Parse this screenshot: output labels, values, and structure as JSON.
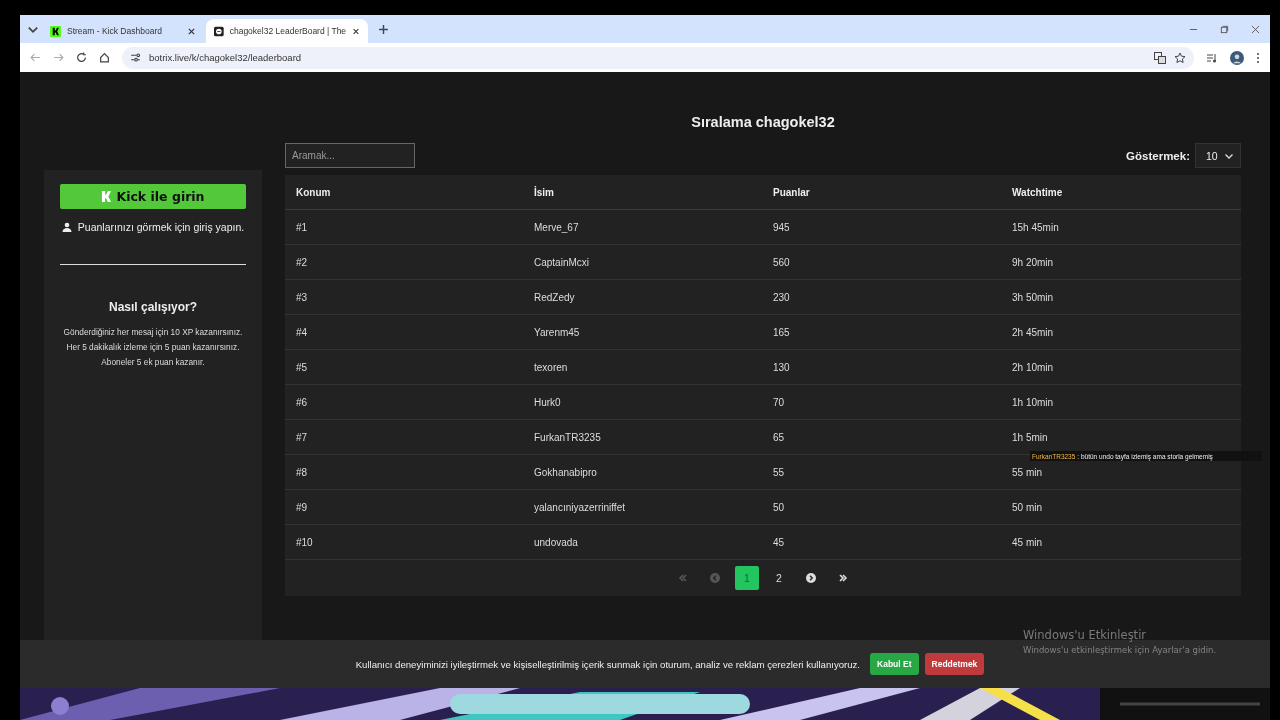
{
  "browser": {
    "tabs": [
      {
        "title": "Stream - Kick Dashboard",
        "kind": "kick",
        "selected": false
      },
      {
        "title": "chagokel32 LeaderBoard | The",
        "kind": "botrix",
        "selected": true
      }
    ],
    "url": "botrix.live/k/chagokel32/leaderboard"
  },
  "sidebar": {
    "login_button": "Kick ile girin",
    "login_hint": "Puanlarınızı görmek için giriş yapın.",
    "how_title": "Nasıl çalışıyor?",
    "how_lines": [
      "Gönderdiğiniz her mesaj için 10 XP kazanırsınız.",
      "Her 5 dakikalık izleme için 5 puan kazanırsınız.",
      "Aboneler 5 ek puan kazanır."
    ]
  },
  "leaderboard": {
    "title": "Sıralama chagokel32",
    "search": {
      "placeholder": "Aramak..."
    },
    "show_label": "Göstermek:",
    "show_value": "10",
    "columns": [
      "Konum",
      "İsim",
      "Puanlar",
      "Watchtime"
    ],
    "rows": [
      [
        "#1",
        "Merve_67",
        "945",
        "15h 45min"
      ],
      [
        "#2",
        "CaptainMcxi",
        "560",
        "9h 20min"
      ],
      [
        "#3",
        "RedZedy",
        "230",
        "3h 50min"
      ],
      [
        "#4",
        "Yarenm45",
        "165",
        "2h 45min"
      ],
      [
        "#5",
        "texoren",
        "130",
        "2h 10min"
      ],
      [
        "#6",
        "Hurk0",
        "70",
        "1h 10min"
      ],
      [
        "#7",
        "FurkanTR3235",
        "65",
        "1h 5min"
      ],
      [
        "#8",
        "Gokhanabipro",
        "55",
        "55 min"
      ],
      [
        "#9",
        "yalancıniyazerriniffet",
        "50",
        "50 min"
      ],
      [
        "#10",
        "undovada",
        "45",
        "45 min"
      ]
    ],
    "pagination": [
      {
        "kind": "first",
        "disabled": true
      },
      {
        "kind": "prev",
        "disabled": true
      },
      {
        "kind": "page",
        "label": "1",
        "selected": true
      },
      {
        "kind": "page",
        "label": "2",
        "selected": false
      },
      {
        "kind": "next",
        "disabled": false
      },
      {
        "kind": "last",
        "disabled": false
      }
    ]
  },
  "chat_overlay": {
    "user": "FurkanTR3235",
    "message": ": bütün undo tayfa izlemiş ama storla gelmemiş"
  },
  "cookie_bar": {
    "text": "Kullanıcı deneyiminizi iyileştirmek ve kişiselleştirilmiş içerik sunmak için oturum, analiz ve reklam çerezleri kullanıyoruz.",
    "accept": "Kabul Et",
    "reject": "Reddetmek"
  },
  "os_watermark": {
    "title": "Windows'u Etkinleştir",
    "subtitle": "Windows'u etkinleştirmek için Ayarlar'a gidin."
  }
}
